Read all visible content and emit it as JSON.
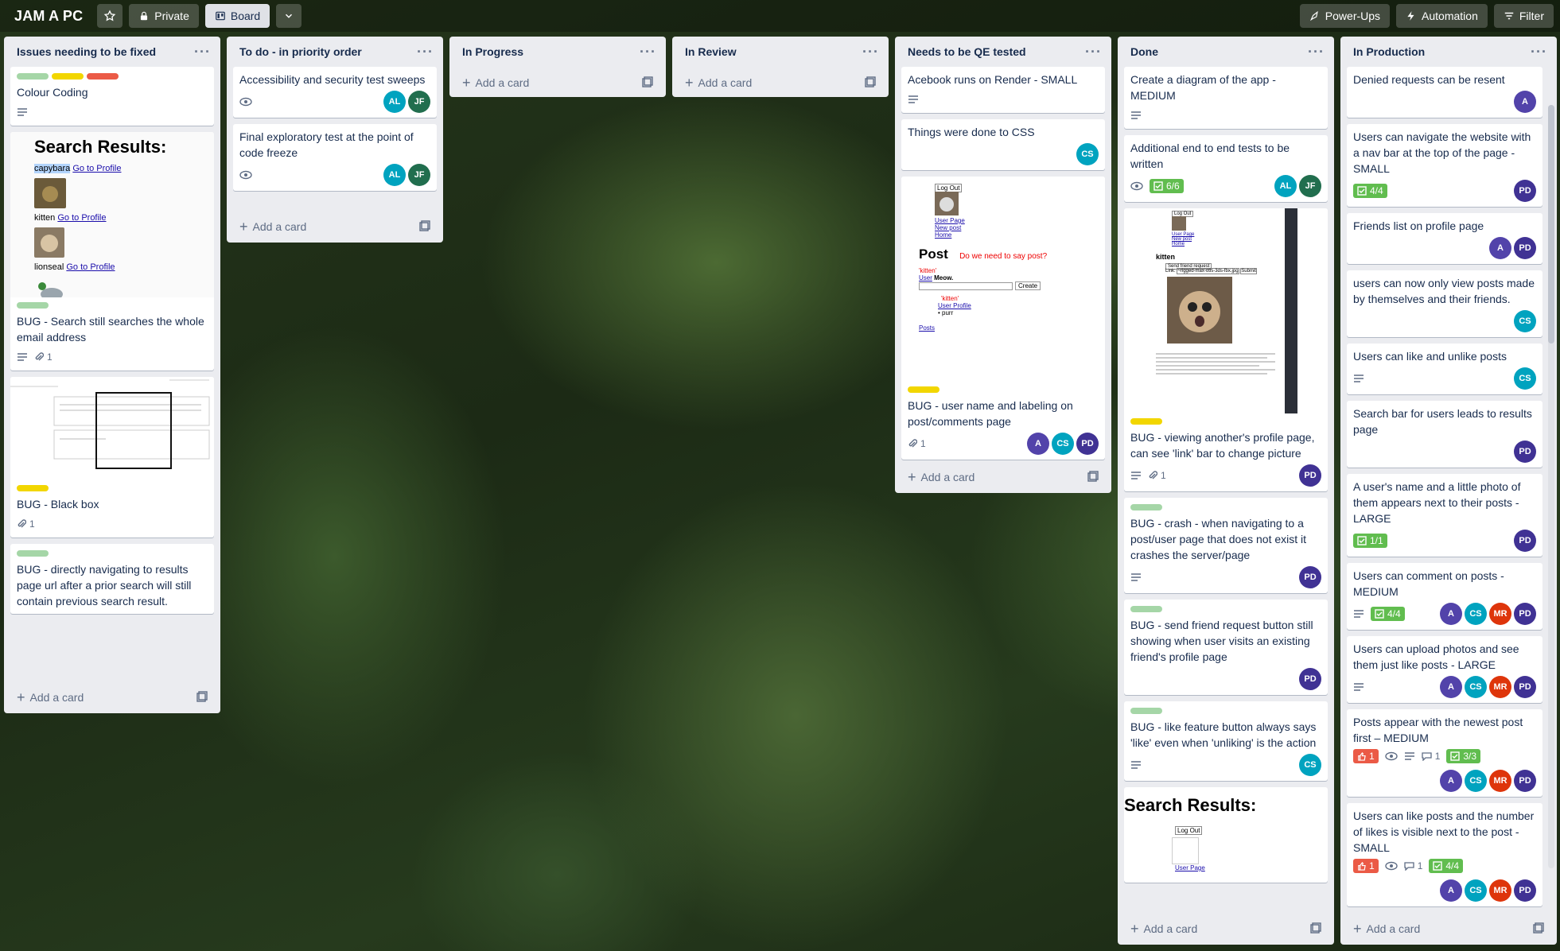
{
  "topbar": {
    "board_title": "JAM A PC",
    "private_label": "Private",
    "board_view_label": "Board",
    "power_ups_label": "Power-Ups",
    "automation_label": "Automation",
    "filter_label": "Filter"
  },
  "common": {
    "add_card": "Add a card"
  },
  "colors": {
    "green": "#61bd4f",
    "yellow": "#f2d600",
    "red": "#eb5a46",
    "green_soft": "#a5d6a7"
  },
  "lists": {
    "issues": {
      "title": "Issues needing to be fixed",
      "cards": {
        "c1": {
          "title": "Colour Coding"
        },
        "c2": {
          "cover": {
            "heading": "Search Results:",
            "r1_name": "capybara",
            "r1_link": "Go to Profile",
            "r2_name": "kitten",
            "r2_link": "Go to Profile",
            "r3_name": "lionseal",
            "r3_link": "Go to Profile"
          },
          "title": "BUG - Search still searches the whole email address",
          "attachments": "1"
        },
        "c3": {
          "title": "BUG - Black box",
          "attachments": "1"
        },
        "c4": {
          "title": "BUG - directly navigating to results page url after a prior search will still contain previous search result."
        }
      }
    },
    "todo": {
      "title": "To do - in priority order",
      "cards": {
        "c1": {
          "title": "Accessibility and security test sweeps",
          "members": [
            "AL",
            "JF"
          ]
        },
        "c2": {
          "title": "Final exploratory test at the point of code freeze",
          "members": [
            "AL",
            "JF"
          ]
        }
      }
    },
    "progress": {
      "title": "In Progress"
    },
    "review": {
      "title": "In Review"
    },
    "qe": {
      "title": "Needs to be QE tested",
      "cards": {
        "c1": {
          "title": "Acebook runs on Render - SMALL"
        },
        "c2": {
          "title": "Things were done to CSS",
          "members": [
            "CS"
          ]
        },
        "c3": {
          "cover": {
            "logout": "Log Out",
            "user_page": "User Page",
            "new_post": "New post",
            "home": "Home",
            "post_heading": "Post",
            "note": "Do we need to say post?",
            "kitten": "'kitten'",
            "user_link": "User",
            "meow": "Meow.",
            "create": "Create",
            "kitten2": "'kitten'",
            "user_profile": "User Profile",
            "purr": "purr",
            "posts": "Posts"
          },
          "title": "BUG - user name and labeling on post/comments page",
          "attachments": "1",
          "members": [
            "A",
            "CS",
            "PD"
          ]
        }
      }
    },
    "done": {
      "title": "Done",
      "cards": {
        "c1": {
          "title": "Create a diagram of the app - MEDIUM"
        },
        "c2": {
          "title": "Additional end to end tests to be written",
          "checklist": "6/6",
          "members": [
            "AL",
            "JF"
          ]
        },
        "c3": {
          "cover": {
            "logout": "Log Out",
            "user_page": "User Page",
            "new_post": "New post",
            "home": "Home",
            "kitten": "kitten",
            "send": "Send friend request",
            "link_label": "Link:",
            "file": "~rigged-max-otis-3ds-fbx.jpg",
            "submit": "Submit"
          },
          "title": "BUG - viewing another's profile page, can see 'link' bar to change picture",
          "attachments": "1",
          "members": [
            "PD"
          ]
        },
        "c4": {
          "title": "BUG - crash - when navigating to a post/user page that does not exist it crashes the server/page",
          "members": [
            "PD"
          ]
        },
        "c5": {
          "title": "BUG - send friend request button still showing when user visits an existing friend's profile page",
          "members": [
            "PD"
          ]
        },
        "c6": {
          "title": "BUG - like feature button always says 'like' even when 'unliking' is the action",
          "members": [
            "CS"
          ]
        },
        "c7": {
          "cover": {
            "heading": "Search Results:",
            "logout": "Log Out",
            "user_page": "User Page"
          }
        }
      }
    },
    "production": {
      "title": "In Production",
      "cards": {
        "c1": {
          "title": "Denied requests can be resent",
          "members": [
            "A"
          ]
        },
        "c2": {
          "title": "Users can navigate the website with a nav bar at the top of the page - SMALL",
          "checklist": "4/4",
          "members": [
            "PD"
          ]
        },
        "c3": {
          "title": "Friends list on profile page",
          "members": [
            "A",
            "PD"
          ]
        },
        "c4": {
          "title": "users can now only view posts made by themselves and their friends.",
          "members": [
            "CS"
          ]
        },
        "c5": {
          "title": "Users can like and unlike posts",
          "members": [
            "CS"
          ]
        },
        "c6": {
          "title": "Search bar for users leads to results page",
          "members": [
            "PD"
          ]
        },
        "c7": {
          "title": "A user's name and a little photo of them appears next to their posts - LARGE",
          "checklist": "1/1",
          "members": [
            "PD"
          ]
        },
        "c8": {
          "title": "Users can comment on posts - MEDIUM",
          "checklist": "4/4",
          "members": [
            "A",
            "CS",
            "MR",
            "PD"
          ]
        },
        "c9": {
          "title": "Users can upload photos and see them just like posts - LARGE",
          "members": [
            "A",
            "CS",
            "MR",
            "PD"
          ]
        },
        "c10": {
          "title": "Posts appear with the newest post first – MEDIUM",
          "votes": "1",
          "comments": "1",
          "checklist": "3/3",
          "members": [
            "A",
            "CS",
            "MR",
            "PD"
          ]
        },
        "c11": {
          "title": "Users can like posts and the number of likes is visible next to the post - SMALL",
          "votes": "1",
          "comments": "1",
          "checklist": "4/4",
          "members": [
            "A",
            "CS",
            "MR",
            "PD"
          ]
        }
      }
    }
  }
}
